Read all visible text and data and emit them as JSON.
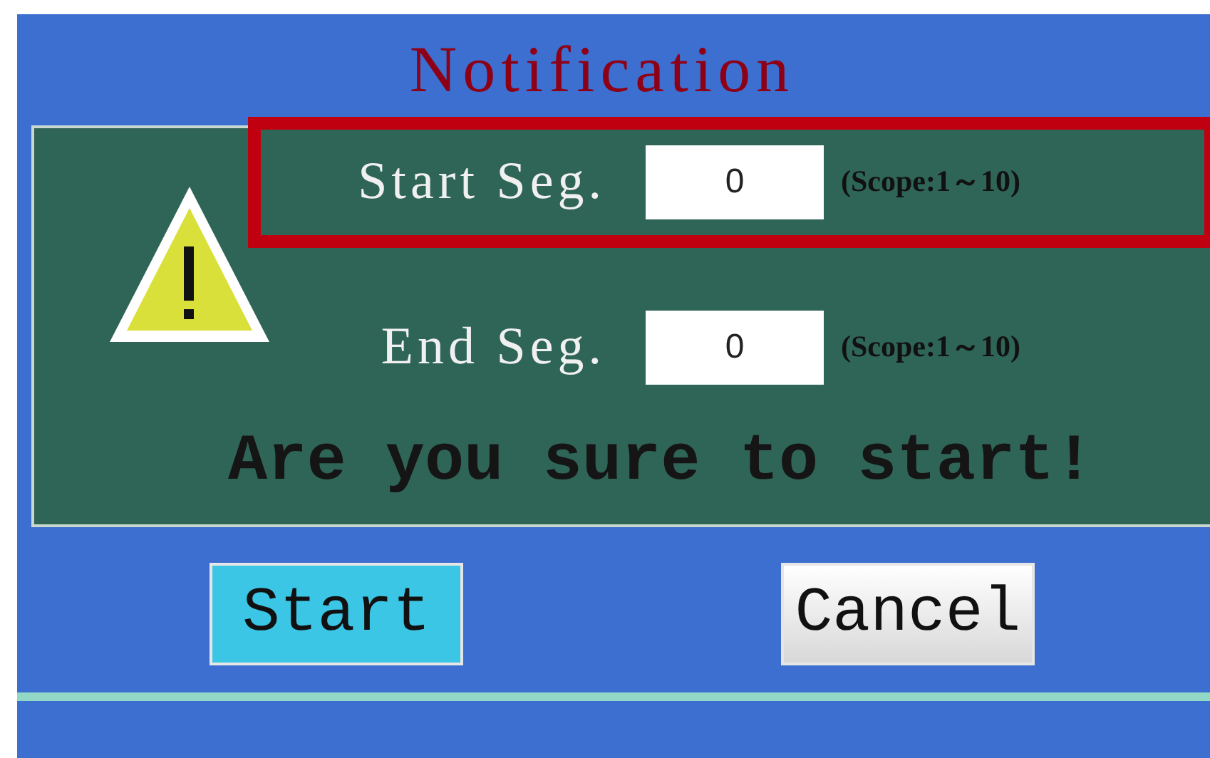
{
  "title": "Notification",
  "fields": [
    {
      "label": "Start Seg.",
      "value": "0",
      "scope": "(Scope:1～10)",
      "highlighted": true
    },
    {
      "label": "End Seg.",
      "value": "0",
      "scope": "(Scope:1～10)",
      "highlighted": false
    }
  ],
  "message": "Are you sure to start!",
  "buttons": [
    {
      "label": "Start",
      "kind": "primary"
    },
    {
      "label": "Cancel",
      "kind": "secondary"
    }
  ]
}
